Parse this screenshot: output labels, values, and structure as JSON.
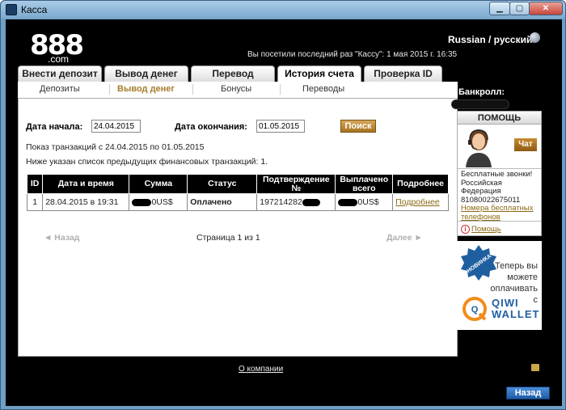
{
  "window": {
    "title": "Касса",
    "min_label": "▁",
    "max_label": "▢",
    "close_label": "✕"
  },
  "header": {
    "logo_text": "888",
    "logo_suffix": ".com",
    "language": "Russian / русский",
    "last_visit": "Вы посетили последний раз \"Кассу\": 1 мая 2015 г. 16:35"
  },
  "tabs": [
    {
      "label": "Внести депозит"
    },
    {
      "label": "Вывод денег"
    },
    {
      "label": "Перевод"
    },
    {
      "label": "История счета"
    },
    {
      "label": "Проверка ID"
    }
  ],
  "active_tab": "История счета",
  "subtabs": [
    {
      "label": "Депозиты"
    },
    {
      "label": "Вывод денег"
    },
    {
      "label": "Бонусы"
    },
    {
      "label": "Переводы"
    }
  ],
  "active_subtab": "Вывод денег",
  "filter": {
    "start_label": "Дата начала:",
    "start_value": "24.04.2015",
    "end_label": "Дата окончания:",
    "end_value": "01.05.2015",
    "search_button": "Поиск"
  },
  "info": {
    "line1": "Показ транзакций с 24.04.2015 по 01.05.2015",
    "line2": "Ниже указан список предыдущих финансовых транзакций: 1."
  },
  "table": {
    "headers": [
      "ID",
      "Дата и время",
      "Сумма",
      "Статус",
      "Подтверждение №",
      "Выплачено всего",
      "Подробнее"
    ],
    "rows": [
      {
        "id": "1",
        "datetime": "28.04.2015 в 19:31",
        "amount": "0US$",
        "status": "Оплачено",
        "confirmation": "197214282",
        "paid_total": "0US$",
        "detail": "Подробнее"
      }
    ]
  },
  "pager": {
    "prev": "◄ Назад",
    "page_text": "Страница 1 из 1",
    "next": "Далее ►"
  },
  "footer": {
    "about": "О компании",
    "back_button": "Назад"
  },
  "sidebar": {
    "bankroll_label": "Банкролл:",
    "help_title": "ПОМОЩЬ",
    "chat_button": "Чат",
    "free_calls": "Бесплатные звонки! Российская Федерация 81080022675011",
    "free_numbers_link": "Номера бесплатных телефонов",
    "help_link": "Помощь",
    "info_icon": "i",
    "badge_text": "НОВИНКА",
    "promo_text": "Теперь вы можете оплачивать с",
    "wallet_text": "QIWI WALLET",
    "qiwi_letter": "Q"
  },
  "colors": {
    "accent_gold": "#8b6914",
    "frame_blue": "#6f9fc4",
    "badge_blue": "#1f5fa0"
  }
}
